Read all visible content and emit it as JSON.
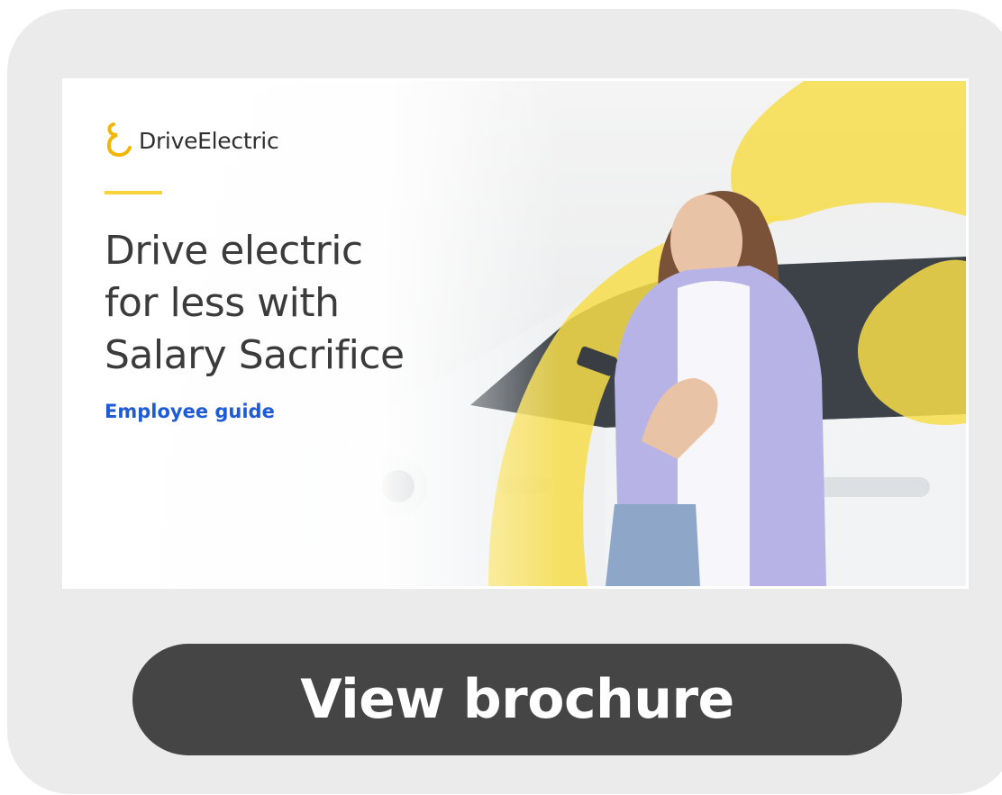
{
  "banner": {
    "brand": "DriveElectric",
    "headline_lines": [
      "Drive electric",
      "for less with",
      "Salary Sacrifice"
    ],
    "subheading": "Employee guide",
    "accent_color": "#f7d23a",
    "subheading_color": "#1f5bd6",
    "logo_icon": "drive-electric-logo-icon",
    "photo": "woman-with-phone-by-electric-car"
  },
  "cta": {
    "label": "View brochure",
    "background_color": "#454545"
  }
}
